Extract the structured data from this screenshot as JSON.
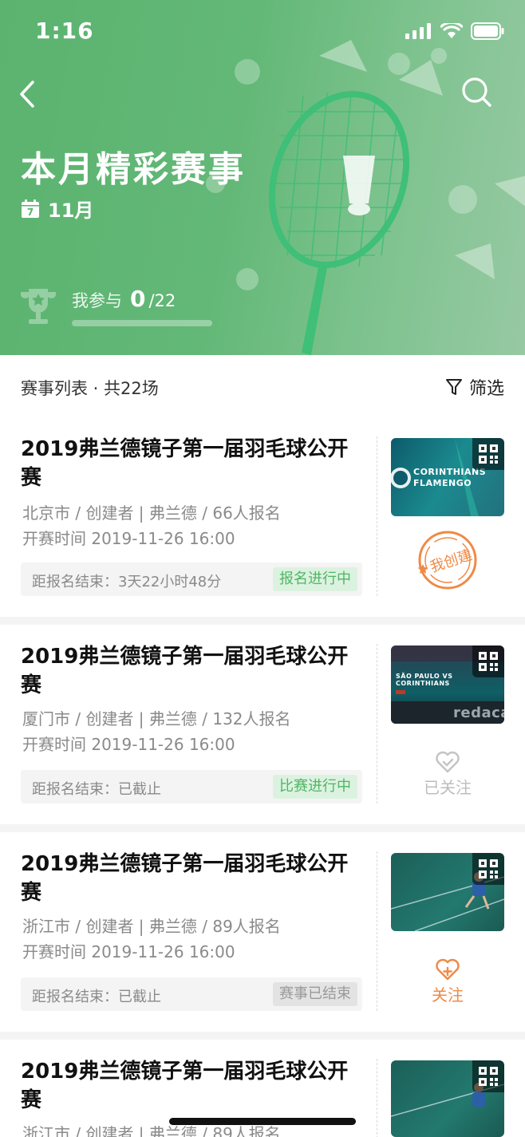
{
  "status_bar": {
    "time": "1:16"
  },
  "header": {
    "title": "本月精彩赛事",
    "month": "11月",
    "calendar_day": "7",
    "participate_label": "我参与",
    "participate_count": "0",
    "participate_total": "/22",
    "participate_progress": 0
  },
  "list": {
    "title": "赛事列表 · 共22场",
    "filter_label": "筛选"
  },
  "cards": [
    {
      "title": "2019弗兰德镜子第一届羽毛球公开赛",
      "location_line": "北京市 / 创建者 | 弗兰德 / 66人报名",
      "time_line": "开赛时间 2019-11-26 16:00",
      "deadline": "距报名结束：3天22小时48分",
      "status": "报名进行中",
      "action": "我创建",
      "thumb_text_1": "CORINTHIANS",
      "thumb_text_2": "FLAMENGO"
    },
    {
      "title": "2019弗兰德镜子第一届羽毛球公开赛",
      "location_line": "厦门市 / 创建者 | 弗兰德 / 132人报名",
      "time_line": "开赛时间 2019-11-26 16:00",
      "deadline": "距报名结束：已截止",
      "status": "比赛进行中",
      "action": "已关注",
      "thumb_text_1": "SÃO PAULO VS CORINTHIANS",
      "thumb_text_2": "redaca"
    },
    {
      "title": "2019弗兰德镜子第一届羽毛球公开赛",
      "location_line": "浙江市 / 创建者 | 弗兰德 / 89人报名",
      "time_line": "开赛时间 2019-11-26 16:00",
      "deadline": "距报名结束：已截止",
      "status": "赛事已结束",
      "action": "关注"
    },
    {
      "title": "2019弗兰德镜子第一届羽毛球公开赛",
      "location_line": "浙江市 / 创建者 | 弗兰德 / 89人报名"
    }
  ],
  "colors": {
    "brand_green": "#5bb36f",
    "status_green": "#4fb663",
    "accent_orange": "#ef8a46",
    "muted_gray": "#8a8a8a"
  },
  "icons": [
    "back-icon",
    "search-icon",
    "calendar-icon",
    "trophy-icon",
    "filter-icon",
    "qr-code-icon",
    "heart-icon",
    "heart-add-icon",
    "created-stamp-icon"
  ]
}
